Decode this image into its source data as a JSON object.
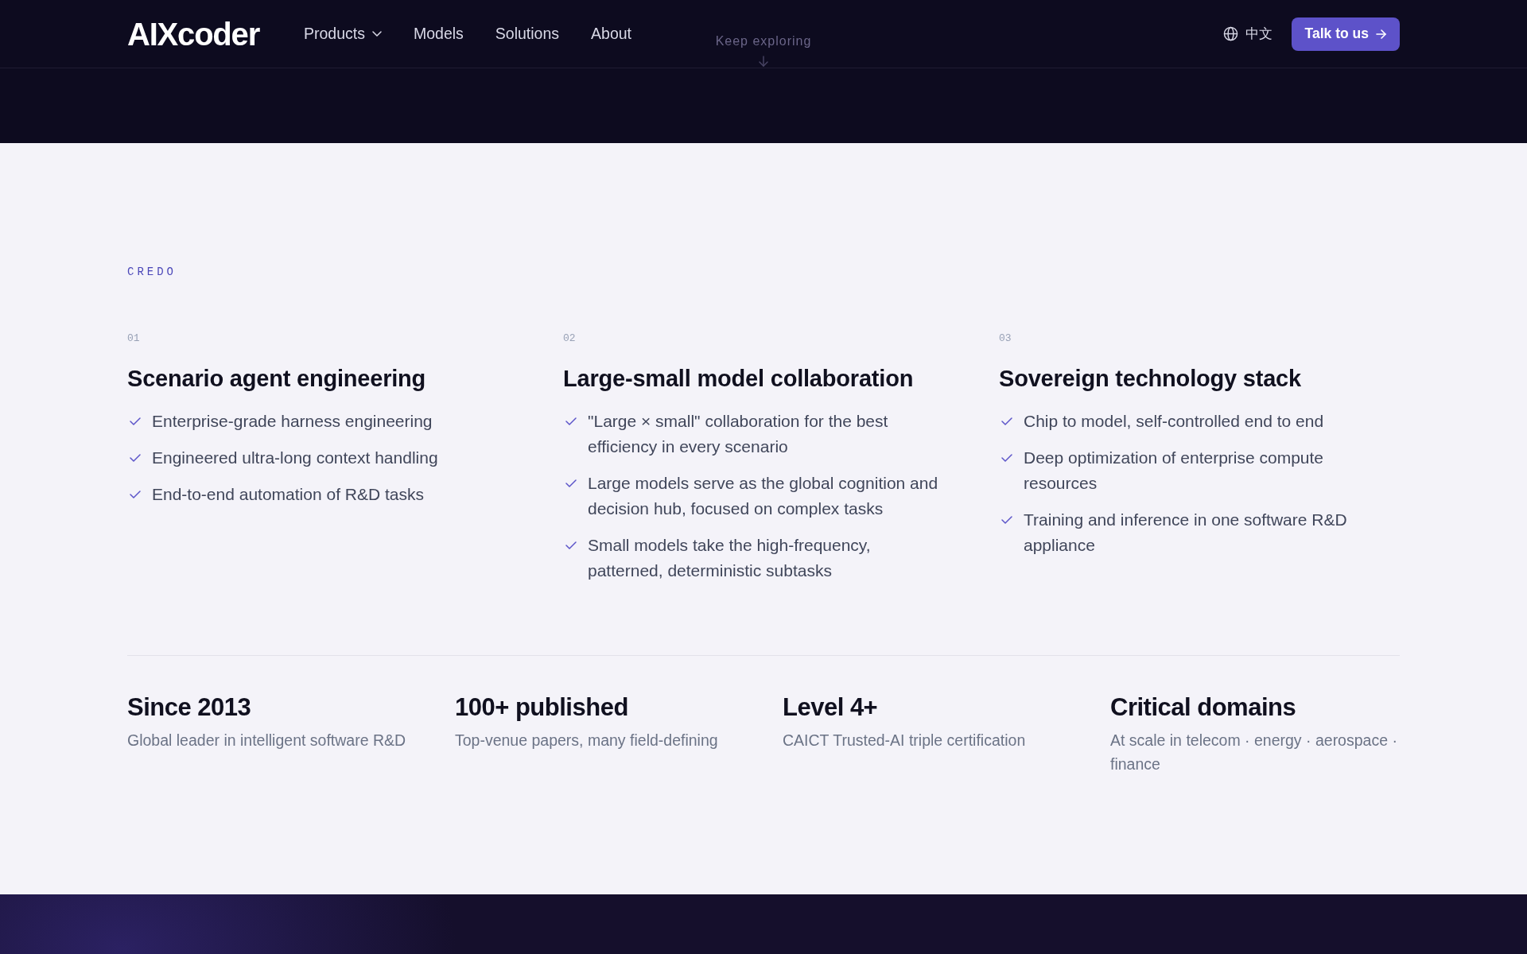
{
  "header": {
    "logo": "AIXcoder",
    "nav": [
      {
        "label": "Products",
        "kind": "dropdown"
      },
      {
        "label": "Models",
        "kind": "link"
      },
      {
        "label": "Solutions",
        "kind": "link"
      },
      {
        "label": "About",
        "kind": "link"
      }
    ],
    "language": "中文",
    "cta": "Talk to us"
  },
  "hero": {
    "scroll_hint": "Keep exploring"
  },
  "credo": {
    "eyebrow": "CREDO",
    "columns": [
      {
        "number": "01",
        "title": "Scenario agent engineering",
        "points": [
          "Enterprise-grade harness engineering",
          "Engineered ultra-long context handling",
          "End-to-end automation of R&D tasks"
        ]
      },
      {
        "number": "02",
        "title": "Large-small model collaboration",
        "points": [
          "\"Large × small\" collaboration for the best efficiency in every scenario",
          "Large models serve as the global cognition and decision hub, focused on complex tasks",
          "Small models take the high-frequency, patterned, deterministic subtasks"
        ]
      },
      {
        "number": "03",
        "title": "Sovereign technology stack",
        "points": [
          "Chip to model, self-controlled end to end",
          "Deep optimization of enterprise compute resources",
          "Training and inference in one software R&D appliance"
        ]
      }
    ]
  },
  "stats": [
    {
      "title": "Since 2013",
      "caption": "Global leader in intelligent software R&D"
    },
    {
      "title": "100+ published",
      "caption": "Top-venue papers, many field-defining"
    },
    {
      "title": "Level 4+",
      "caption": "CAICT Trusted-AI triple certification"
    },
    {
      "title": "Critical domains",
      "caption": "At scale in telecom · energy · aerospace · finance"
    }
  ]
}
